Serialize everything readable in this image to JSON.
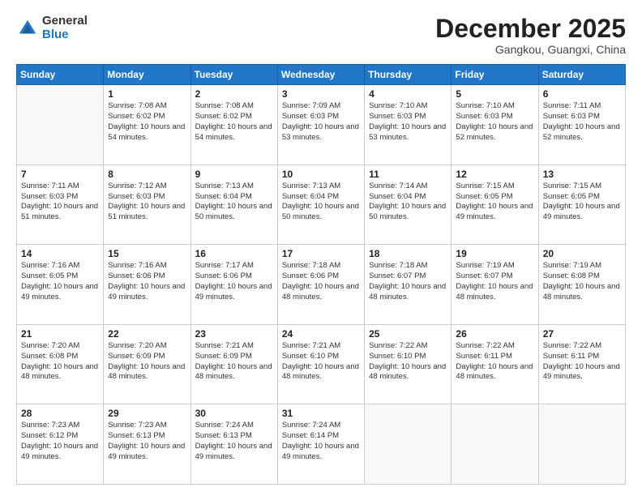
{
  "logo": {
    "general": "General",
    "blue": "Blue"
  },
  "header": {
    "month": "December 2025",
    "location": "Gangkou, Guangxi, China"
  },
  "days_of_week": [
    "Sunday",
    "Monday",
    "Tuesday",
    "Wednesday",
    "Thursday",
    "Friday",
    "Saturday"
  ],
  "weeks": [
    [
      {
        "day": "",
        "info": ""
      },
      {
        "day": "1",
        "info": "Sunrise: 7:08 AM\nSunset: 6:02 PM\nDaylight: 10 hours\nand 54 minutes."
      },
      {
        "day": "2",
        "info": "Sunrise: 7:08 AM\nSunset: 6:02 PM\nDaylight: 10 hours\nand 54 minutes."
      },
      {
        "day": "3",
        "info": "Sunrise: 7:09 AM\nSunset: 6:03 PM\nDaylight: 10 hours\nand 53 minutes."
      },
      {
        "day": "4",
        "info": "Sunrise: 7:10 AM\nSunset: 6:03 PM\nDaylight: 10 hours\nand 53 minutes."
      },
      {
        "day": "5",
        "info": "Sunrise: 7:10 AM\nSunset: 6:03 PM\nDaylight: 10 hours\nand 52 minutes."
      },
      {
        "day": "6",
        "info": "Sunrise: 7:11 AM\nSunset: 6:03 PM\nDaylight: 10 hours\nand 52 minutes."
      }
    ],
    [
      {
        "day": "7",
        "info": "Sunrise: 7:11 AM\nSunset: 6:03 PM\nDaylight: 10 hours\nand 51 minutes."
      },
      {
        "day": "8",
        "info": "Sunrise: 7:12 AM\nSunset: 6:03 PM\nDaylight: 10 hours\nand 51 minutes."
      },
      {
        "day": "9",
        "info": "Sunrise: 7:13 AM\nSunset: 6:04 PM\nDaylight: 10 hours\nand 50 minutes."
      },
      {
        "day": "10",
        "info": "Sunrise: 7:13 AM\nSunset: 6:04 PM\nDaylight: 10 hours\nand 50 minutes."
      },
      {
        "day": "11",
        "info": "Sunrise: 7:14 AM\nSunset: 6:04 PM\nDaylight: 10 hours\nand 50 minutes."
      },
      {
        "day": "12",
        "info": "Sunrise: 7:15 AM\nSunset: 6:05 PM\nDaylight: 10 hours\nand 49 minutes."
      },
      {
        "day": "13",
        "info": "Sunrise: 7:15 AM\nSunset: 6:05 PM\nDaylight: 10 hours\nand 49 minutes."
      }
    ],
    [
      {
        "day": "14",
        "info": "Sunrise: 7:16 AM\nSunset: 6:05 PM\nDaylight: 10 hours\nand 49 minutes."
      },
      {
        "day": "15",
        "info": "Sunrise: 7:16 AM\nSunset: 6:06 PM\nDaylight: 10 hours\nand 49 minutes."
      },
      {
        "day": "16",
        "info": "Sunrise: 7:17 AM\nSunset: 6:06 PM\nDaylight: 10 hours\nand 49 minutes."
      },
      {
        "day": "17",
        "info": "Sunrise: 7:18 AM\nSunset: 6:06 PM\nDaylight: 10 hours\nand 48 minutes."
      },
      {
        "day": "18",
        "info": "Sunrise: 7:18 AM\nSunset: 6:07 PM\nDaylight: 10 hours\nand 48 minutes."
      },
      {
        "day": "19",
        "info": "Sunrise: 7:19 AM\nSunset: 6:07 PM\nDaylight: 10 hours\nand 48 minutes."
      },
      {
        "day": "20",
        "info": "Sunrise: 7:19 AM\nSunset: 6:08 PM\nDaylight: 10 hours\nand 48 minutes."
      }
    ],
    [
      {
        "day": "21",
        "info": "Sunrise: 7:20 AM\nSunset: 6:08 PM\nDaylight: 10 hours\nand 48 minutes."
      },
      {
        "day": "22",
        "info": "Sunrise: 7:20 AM\nSunset: 6:09 PM\nDaylight: 10 hours\nand 48 minutes."
      },
      {
        "day": "23",
        "info": "Sunrise: 7:21 AM\nSunset: 6:09 PM\nDaylight: 10 hours\nand 48 minutes."
      },
      {
        "day": "24",
        "info": "Sunrise: 7:21 AM\nSunset: 6:10 PM\nDaylight: 10 hours\nand 48 minutes."
      },
      {
        "day": "25",
        "info": "Sunrise: 7:22 AM\nSunset: 6:10 PM\nDaylight: 10 hours\nand 48 minutes."
      },
      {
        "day": "26",
        "info": "Sunrise: 7:22 AM\nSunset: 6:11 PM\nDaylight: 10 hours\nand 48 minutes."
      },
      {
        "day": "27",
        "info": "Sunrise: 7:22 AM\nSunset: 6:11 PM\nDaylight: 10 hours\nand 49 minutes."
      }
    ],
    [
      {
        "day": "28",
        "info": "Sunrise: 7:23 AM\nSunset: 6:12 PM\nDaylight: 10 hours\nand 49 minutes."
      },
      {
        "day": "29",
        "info": "Sunrise: 7:23 AM\nSunset: 6:13 PM\nDaylight: 10 hours\nand 49 minutes."
      },
      {
        "day": "30",
        "info": "Sunrise: 7:24 AM\nSunset: 6:13 PM\nDaylight: 10 hours\nand 49 minutes."
      },
      {
        "day": "31",
        "info": "Sunrise: 7:24 AM\nSunset: 6:14 PM\nDaylight: 10 hours\nand 49 minutes."
      },
      {
        "day": "",
        "info": ""
      },
      {
        "day": "",
        "info": ""
      },
      {
        "day": "",
        "info": ""
      }
    ]
  ]
}
